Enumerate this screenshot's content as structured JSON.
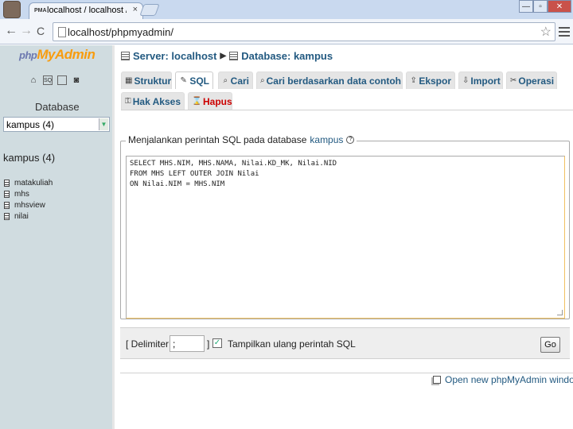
{
  "browser": {
    "tab_title": "localhost / localhost / kampus",
    "favicon_text": "PMA",
    "tab_close": "×",
    "back": "←",
    "forward": "→",
    "reload": "C",
    "url": "localhost/phpmyadmin/",
    "star": "☆",
    "window_buttons": [
      "—",
      "▫",
      "✕"
    ]
  },
  "left": {
    "logo": {
      "php": "php",
      "my": "My",
      "admin": "Admin"
    },
    "icons": [
      "home-icon",
      "logout-icon",
      "query-window-icon",
      "docs-icon"
    ],
    "database_label": "Database",
    "select_value": "kampus (4)",
    "db_heading": "kampus (4)",
    "tables": [
      "matakuliah",
      "mhs",
      "mhsview",
      "nilai"
    ]
  },
  "main": {
    "breadcrumb": {
      "server": "Server: localhost",
      "database": "Database: kampus",
      "sep": "▶"
    },
    "tabs": [
      {
        "label": "Struktur",
        "icon": "▦"
      },
      {
        "label": "SQL",
        "icon": "✎",
        "active": true
      },
      {
        "label": "Cari",
        "icon": "⌕"
      },
      {
        "label": "Cari berdasarkan data contoh",
        "icon": "⌕"
      },
      {
        "label": "Ekspor",
        "icon": "⇪"
      },
      {
        "label": "Import",
        "icon": "⇩"
      },
      {
        "label": "Operasi",
        "icon": "✂"
      }
    ],
    "tabs_row2": [
      {
        "label": "Hak Akses",
        "icon": "⚿"
      },
      {
        "label": "Hapus",
        "icon": "⌛"
      }
    ],
    "legend_prefix": "Menjalankan perintah SQL pada database",
    "legend_db": "kampus",
    "help": "?",
    "sql": "SELECT MHS.NIM, MHS.NAMA, Nilai.KD_MK, Nilai.NID\nFROM MHS LEFT OUTER JOIN Nilai\nON Nilai.NIM = MHS.NIM",
    "delimiter_label": "[ Delimiter",
    "delimiter_value": ";",
    "delimiter_close": "]",
    "show_query_label": "Tampilkan ulang perintah SQL",
    "show_query_checked": "✓",
    "go": "Go",
    "new_window": "Open new phpMyAdmin window"
  }
}
